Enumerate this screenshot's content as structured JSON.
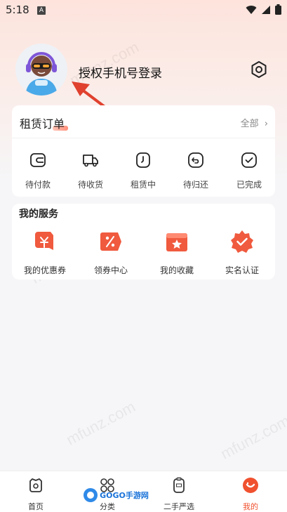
{
  "status_bar": {
    "time": "5:18",
    "badge": "A"
  },
  "profile": {
    "login_text": "授权手机号登录"
  },
  "orders": {
    "title": "租赁订单",
    "all_link": "全部",
    "items": [
      {
        "label": "待付款",
        "icon": "wallet-icon"
      },
      {
        "label": "待收货",
        "icon": "truck-icon"
      },
      {
        "label": "租赁中",
        "icon": "clock-icon"
      },
      {
        "label": "待归还",
        "icon": "return-icon"
      },
      {
        "label": "已完成",
        "icon": "check-icon"
      }
    ]
  },
  "services": {
    "title": "我的服务",
    "items": [
      {
        "label": "我的优惠券",
        "icon": "coupon-icon"
      },
      {
        "label": "领券中心",
        "icon": "percent-tag-icon"
      },
      {
        "label": "我的收藏",
        "icon": "favorite-box-icon"
      },
      {
        "label": "实名认证",
        "icon": "verified-badge-icon"
      }
    ]
  },
  "watermark": "mfunz.com",
  "tabbar": {
    "items": [
      {
        "label": "首页",
        "icon": "home-icon"
      },
      {
        "label": "分类",
        "icon": "category-icon"
      },
      {
        "label": "二手严选",
        "icon": "secondhand-icon"
      },
      {
        "label": "我的",
        "icon": "profile-icon"
      }
    ]
  },
  "overlay_logo": "GOGO手游网",
  "colors": {
    "accent": "#f0512f",
    "arrow": "#e0412e"
  }
}
